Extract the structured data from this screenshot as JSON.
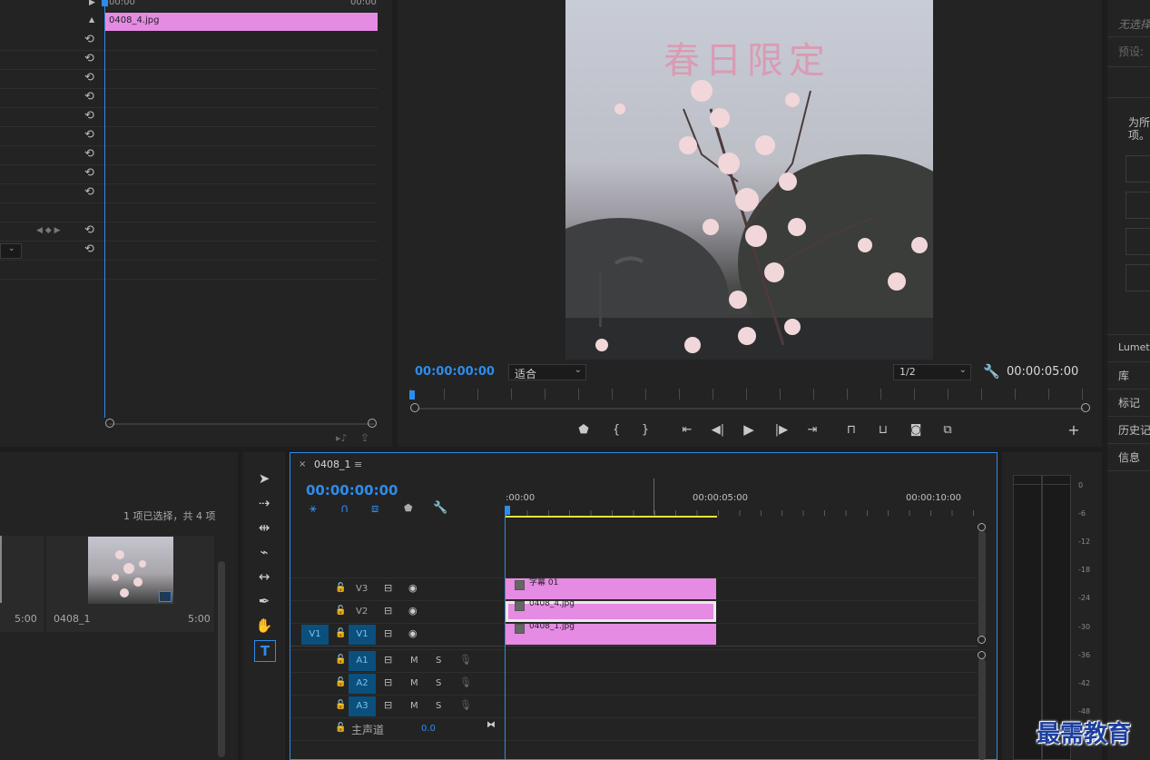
{
  "effect_controls": {
    "timecode_start": "00:00",
    "timecode_end": "00:00",
    "clip_name": "0408_4.jpg"
  },
  "program_monitor": {
    "watermark_text": "春日限定",
    "current_time": "00:00:00:00",
    "fit_label": "适合",
    "resolution_label": "1/2",
    "duration": "00:00:05:00"
  },
  "project_panel": {
    "selection_info": "1 项已选择，共 4 项",
    "items": [
      {
        "name": "",
        "duration": "5:00"
      },
      {
        "name": "0408_1",
        "duration": "5:00"
      }
    ]
  },
  "timeline": {
    "sequence_name": "0408_1",
    "current_time": "00:00:00:00",
    "ruler_labels": [
      ":00:00",
      "00:00:05:00",
      "00:00:10:00"
    ],
    "video_tracks": [
      {
        "label": "V3",
        "clip": "字幕 01"
      },
      {
        "label": "V2",
        "clip": "0408_4.jpg"
      },
      {
        "label": "V1",
        "source": "V1",
        "clip": "0408_1.jpg"
      }
    ],
    "audio_tracks": [
      {
        "label": "A1",
        "m": "M",
        "s": "S"
      },
      {
        "label": "A2",
        "m": "M",
        "s": "S"
      },
      {
        "label": "A3",
        "m": "M",
        "s": "S"
      }
    ],
    "master_label": "主声道",
    "master_value": "0.0"
  },
  "audio_meter": {
    "labels": [
      "0",
      "-6",
      "-12",
      "-18",
      "-24",
      "-30",
      "-36",
      "-42",
      "-48"
    ]
  },
  "right_panel": {
    "top_text": "无选择",
    "preset_label": "预设:",
    "message": "为所\n项。",
    "tabs": [
      "Lumetri",
      "库",
      "标记",
      "历史记",
      "信息"
    ]
  },
  "brand_watermark": "最需教育",
  "colors": {
    "accent_blue": "#2d8ceb",
    "clip_pink": "#e58be3",
    "work_area_yellow": "#e8e33a"
  }
}
